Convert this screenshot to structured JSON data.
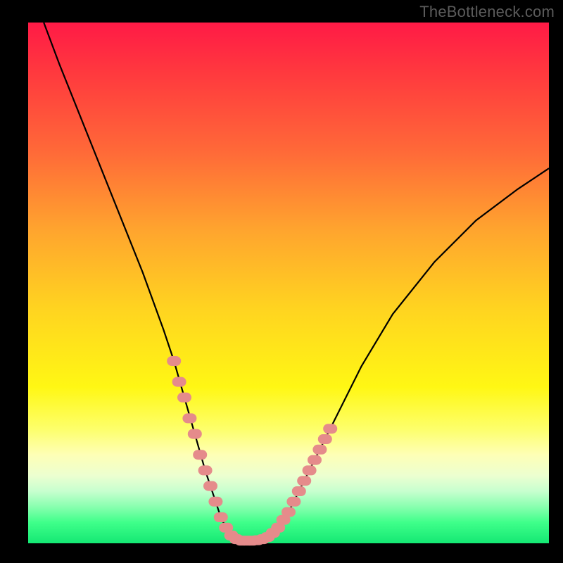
{
  "watermark": "TheBottleneck.com",
  "colors": {
    "frame": "#000000",
    "curve": "#000000",
    "marker_fill": "#e58b8b",
    "gradient_top": "#ff1a46",
    "gradient_bottom": "#14e873"
  },
  "chart_data": {
    "type": "line",
    "title": "",
    "xlabel": "",
    "ylabel": "",
    "xlim": [
      0,
      100
    ],
    "ylim": [
      0,
      100
    ],
    "series": [
      {
        "name": "bottleneck-curve",
        "x": [
          3,
          6,
          10,
          14,
          18,
          22,
          26,
          28,
          30,
          32,
          34,
          36,
          37,
          38,
          39,
          40,
          42,
          44,
          46,
          48,
          50,
          54,
          58,
          64,
          70,
          78,
          86,
          94,
          100
        ],
        "y": [
          100,
          92,
          82,
          72,
          62,
          52,
          41,
          35,
          28,
          21,
          14,
          8,
          5,
          3,
          1.5,
          0.8,
          0.5,
          0.6,
          1.2,
          3,
          6,
          14,
          22,
          34,
          44,
          54,
          62,
          68,
          72
        ]
      }
    ],
    "markers": [
      {
        "x": 28,
        "y": 35
      },
      {
        "x": 29,
        "y": 31
      },
      {
        "x": 30,
        "y": 28
      },
      {
        "x": 31,
        "y": 24
      },
      {
        "x": 32,
        "y": 21
      },
      {
        "x": 33,
        "y": 17
      },
      {
        "x": 34,
        "y": 14
      },
      {
        "x": 35,
        "y": 11
      },
      {
        "x": 36,
        "y": 8
      },
      {
        "x": 37,
        "y": 5
      },
      {
        "x": 38,
        "y": 3
      },
      {
        "x": 39,
        "y": 1.5
      },
      {
        "x": 40,
        "y": 0.8
      },
      {
        "x": 41,
        "y": 0.5
      },
      {
        "x": 42,
        "y": 0.5
      },
      {
        "x": 43,
        "y": 0.5
      },
      {
        "x": 44,
        "y": 0.6
      },
      {
        "x": 45,
        "y": 0.8
      },
      {
        "x": 46,
        "y": 1.2
      },
      {
        "x": 47,
        "y": 2
      },
      {
        "x": 48,
        "y": 3
      },
      {
        "x": 49,
        "y": 4.5
      },
      {
        "x": 50,
        "y": 6
      },
      {
        "x": 51,
        "y": 8
      },
      {
        "x": 52,
        "y": 10
      },
      {
        "x": 53,
        "y": 12
      },
      {
        "x": 54,
        "y": 14
      },
      {
        "x": 55,
        "y": 16
      },
      {
        "x": 56,
        "y": 18
      },
      {
        "x": 57,
        "y": 20
      },
      {
        "x": 58,
        "y": 22
      }
    ]
  }
}
